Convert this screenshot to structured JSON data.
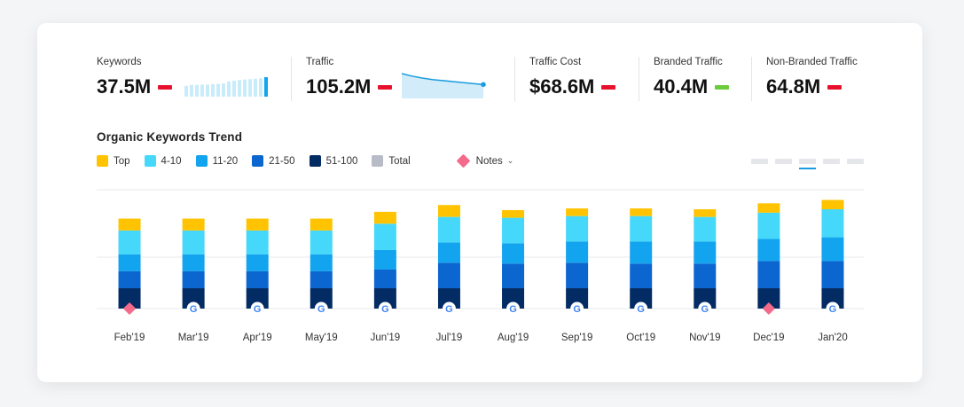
{
  "metrics": [
    {
      "label": "Keywords",
      "value": "37.5M",
      "indicator_color": "#e8112d"
    },
    {
      "label": "Traffic",
      "value": "105.2M",
      "indicator_color": "#e8112d"
    },
    {
      "label": "Traffic Cost",
      "value": "$68.6M",
      "indicator_color": "#e8112d"
    },
    {
      "label": "Branded Traffic",
      "value": "40.4M",
      "indicator_color": "#6ccc3c"
    },
    {
      "label": "Non-Branded Traffic",
      "value": "64.8M",
      "indicator_color": "#e8112d"
    }
  ],
  "keywords_sparkline": [
    0.55,
    0.6,
    0.6,
    0.62,
    0.62,
    0.64,
    0.66,
    0.68,
    0.78,
    0.82,
    0.85,
    0.88,
    0.9,
    0.92,
    0.95,
    1.0
  ],
  "traffic_sparkline": [
    1.0,
    0.9,
    0.82,
    0.76,
    0.72,
    0.68,
    0.64,
    0.6,
    0.56
  ],
  "section_title": "Organic Keywords Trend",
  "legend": [
    {
      "label": "Top",
      "color": "#ffc300"
    },
    {
      "label": "4-10",
      "color": "#45d8fa"
    },
    {
      "label": "11-20",
      "color": "#12a4ee"
    },
    {
      "label": "21-50",
      "color": "#0b66d0"
    },
    {
      "label": "51-100",
      "color": "#032b64"
    },
    {
      "label": "Total",
      "color": "#b8bcc7"
    }
  ],
  "notes_label": "Notes",
  "notes_color": "#f46a8a",
  "chart_data": {
    "type": "bar",
    "stacked": true,
    "categories": [
      "Feb'19",
      "Mar'19",
      "Apr'19",
      "May'19",
      "Jun'19",
      "Jul'19",
      "Aug'19",
      "Sep'19",
      "Oct'19",
      "Nov'19",
      "Dec'19",
      "Jan'20"
    ],
    "series": [
      {
        "name": "51-100",
        "color": "#032b64",
        "values": [
          24,
          24,
          24,
          24,
          24,
          24,
          24,
          24,
          24,
          24,
          24,
          24
        ]
      },
      {
        "name": "21-50",
        "color": "#0b66d0",
        "values": [
          20,
          20,
          20,
          20,
          22,
          30,
          29,
          30,
          29,
          29,
          32,
          32
        ]
      },
      {
        "name": "11-20",
        "color": "#12a4ee",
        "values": [
          20,
          20,
          20,
          20,
          23,
          24,
          24,
          25,
          26,
          26,
          26,
          28
        ]
      },
      {
        "name": "4-10",
        "color": "#45d8fa",
        "values": [
          28,
          28,
          28,
          28,
          31,
          30,
          30,
          30,
          30,
          29,
          31,
          33
        ]
      },
      {
        "name": "Top",
        "color": "#ffc300",
        "values": [
          14,
          14,
          14,
          14,
          14,
          14,
          9,
          9,
          9,
          9,
          11,
          11
        ]
      }
    ],
    "event_markers": [
      "note",
      "google",
      "google",
      "google",
      "google",
      "google",
      "google",
      "google",
      "google",
      "google",
      "note",
      "google"
    ],
    "ylim": [
      0,
      140
    ],
    "grid": true,
    "xlabel": "",
    "ylabel": ""
  }
}
